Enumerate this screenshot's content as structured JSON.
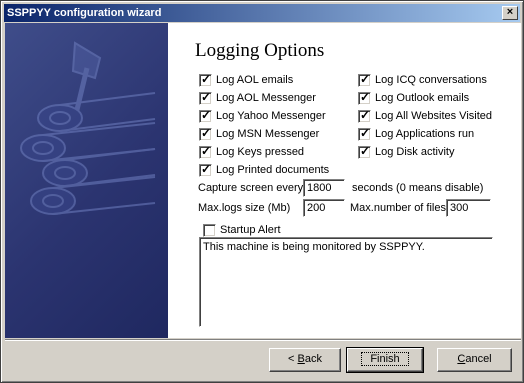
{
  "window": {
    "title": "SSPPYY configuration wizard",
    "close_glyph": "×"
  },
  "page": {
    "heading": "Logging Options"
  },
  "options_left": [
    {
      "label": "Log AOL emails",
      "checked": true
    },
    {
      "label": "Log AOL Messenger",
      "checked": true
    },
    {
      "label": "Log Yahoo Messenger",
      "checked": true
    },
    {
      "label": "Log MSN Messenger",
      "checked": true
    },
    {
      "label": "Log Keys pressed",
      "checked": true
    },
    {
      "label": "Log Printed documents",
      "checked": true
    }
  ],
  "options_right": [
    {
      "label": "Log ICQ conversations",
      "checked": true
    },
    {
      "label": "Log Outlook emails",
      "checked": true
    },
    {
      "label": "Log All Websites Visited",
      "checked": true
    },
    {
      "label": "Log Applications run",
      "checked": true
    },
    {
      "label": "Log Disk activity",
      "checked": true
    }
  ],
  "capture": {
    "label": "Capture screen every",
    "value": "1800",
    "suffix": "seconds (0 means disable)"
  },
  "maxlogs": {
    "label": "Max.logs size (Mb)",
    "value": "200"
  },
  "maxfiles": {
    "label": "Max.number of files",
    "value": "300"
  },
  "startup_alert": {
    "label": "Startup Alert",
    "checked": false
  },
  "alert_message": "This machine is being monitored by SSPPYY.",
  "buttons": {
    "back": {
      "prefix": "< ",
      "access": "B",
      "rest": "ack"
    },
    "finish": "Finish",
    "cancel": {
      "access": "C",
      "rest": "ancel"
    }
  },
  "colors": {
    "side_panel": "#2b3470",
    "title_bar": "#0a246a"
  },
  "icons": {
    "check": "✓",
    "side_graphic": "axe-in-logs-graphic"
  }
}
